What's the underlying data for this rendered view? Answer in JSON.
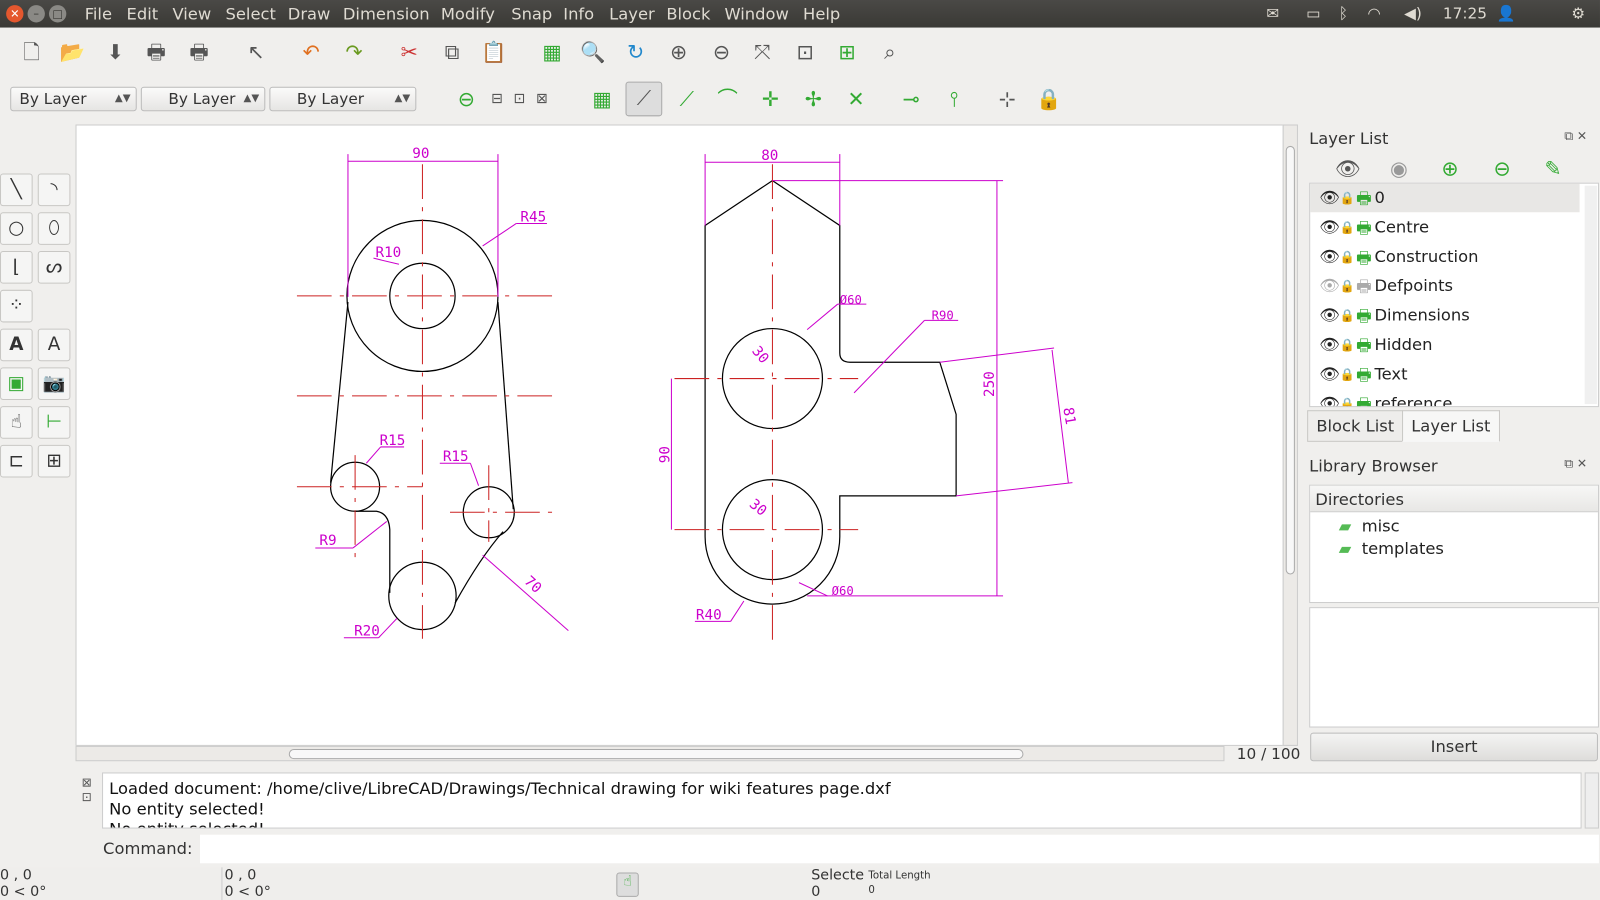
{
  "menu": [
    "File",
    "Edit",
    "View",
    "Select",
    "Draw",
    "Dimension",
    "Modify",
    "Snap",
    "Info",
    "Layer",
    "Block",
    "Window",
    "Help"
  ],
  "tray": {
    "time": "17:25"
  },
  "props": {
    "color": "By Layer",
    "linetype": "By Layer",
    "width": "By Layer"
  },
  "drawing": {
    "left": {
      "dims": [
        "90",
        "R45",
        "R10",
        "R15",
        "R15",
        "R9",
        "70",
        "R20"
      ]
    },
    "right": {
      "dims": [
        "80",
        "Ø60",
        "R90",
        "30",
        "250",
        "81",
        "90",
        "30",
        "Ø60",
        "R40"
      ]
    }
  },
  "canvas": {
    "page": "10 / 100"
  },
  "layer_list": {
    "title": "Layer List",
    "layers": [
      {
        "name": "0",
        "visible": true
      },
      {
        "name": "Centre",
        "visible": true
      },
      {
        "name": "Construction",
        "visible": true
      },
      {
        "name": "Defpoints",
        "visible": false
      },
      {
        "name": "Dimensions",
        "visible": true
      },
      {
        "name": "Hidden",
        "visible": true
      },
      {
        "name": "Text",
        "visible": true
      },
      {
        "name": "reference",
        "visible": true
      }
    ]
  },
  "tabs": [
    "Block List",
    "Layer List"
  ],
  "library": {
    "title": "Library Browser",
    "header": "Directories",
    "dirs": [
      "misc",
      "templates"
    ],
    "insert": "Insert"
  },
  "console": {
    "lines": [
      "Loaded document: /home/clive/LibreCAD/Drawings/Technical drawing for wiki features page.dxf",
      "No entity selected!",
      "No entity selected!"
    ],
    "command_label": "Command:",
    "command_value": ""
  },
  "status": {
    "abs_coord": "0 , 0",
    "abs_polar": "0 < 0°",
    "rel_coord": "0 , 0",
    "rel_polar": "0 < 0°",
    "selected_label": "Selecte",
    "selected_value": "0",
    "total_length_label": "Total Length",
    "total_length_value": "0"
  },
  "colors": {
    "dimension": "#cc00cc",
    "centerline": "#cc2222",
    "outline": "#000000",
    "accent_green": "#44bb22"
  }
}
